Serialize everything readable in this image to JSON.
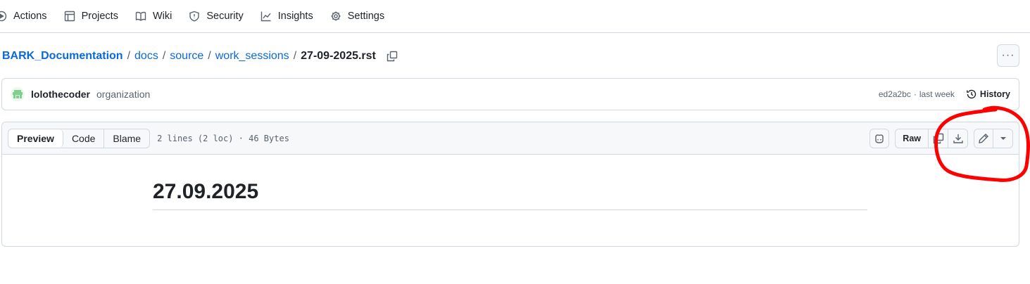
{
  "repo_nav": {
    "items": [
      {
        "label": "Actions",
        "icon": "play-circle-icon"
      },
      {
        "label": "Projects",
        "icon": "table-icon"
      },
      {
        "label": "Wiki",
        "icon": "book-icon"
      },
      {
        "label": "Security",
        "icon": "shield-icon"
      },
      {
        "label": "Insights",
        "icon": "graph-icon"
      },
      {
        "label": "Settings",
        "icon": "gear-icon"
      }
    ]
  },
  "breadcrumb": {
    "root": "BARK_Documentation",
    "segments": [
      "docs",
      "source",
      "work_sessions"
    ],
    "separator": "/",
    "current": "27-09-2025.rst",
    "copy_icon": "copy-icon"
  },
  "more_menu": {
    "label": "···"
  },
  "commit": {
    "author": "lolothecoder",
    "author_type": "organization",
    "sha": "ed2a2bc",
    "dot": "·",
    "time": "last week",
    "history_label": "History"
  },
  "file": {
    "tabs": [
      {
        "label": "Preview",
        "active": true
      },
      {
        "label": "Code",
        "active": false
      },
      {
        "label": "Blame",
        "active": false
      }
    ],
    "info": "2 lines (2 loc) · 46 Bytes",
    "raw_label": "Raw",
    "action_icons": [
      "copilot-icon",
      "copy-icon",
      "download-icon",
      "pencil-icon",
      "triangle-down-icon"
    ],
    "content_heading": "27.09.2025"
  },
  "colors": {
    "link": "#0969da",
    "annotation": "#ff0000",
    "border": "#d1d9e0",
    "header_bg": "#f6f8fa"
  }
}
